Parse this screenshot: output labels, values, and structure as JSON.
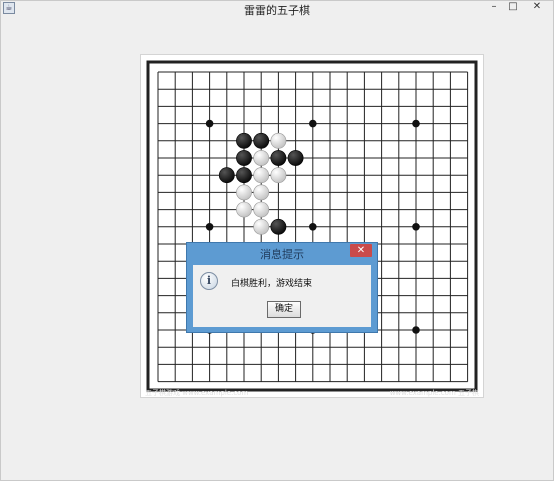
{
  "window": {
    "title": "雷雷的五子棋",
    "minimize_symbol": "–",
    "maximize_symbol": "□",
    "close_symbol": "✕",
    "icon": "java-cup-icon"
  },
  "board": {
    "size": 19,
    "line_color": "#222222",
    "star_points": [
      [
        3,
        3
      ],
      [
        9,
        3
      ],
      [
        15,
        3
      ],
      [
        3,
        9
      ],
      [
        9,
        9
      ],
      [
        15,
        9
      ],
      [
        3,
        15
      ],
      [
        9,
        15
      ],
      [
        15,
        15
      ]
    ],
    "stones": [
      {
        "col": 5,
        "row": 4,
        "color": "black"
      },
      {
        "col": 6,
        "row": 4,
        "color": "black"
      },
      {
        "col": 7,
        "row": 4,
        "color": "white"
      },
      {
        "col": 5,
        "row": 5,
        "color": "black"
      },
      {
        "col": 6,
        "row": 5,
        "color": "white"
      },
      {
        "col": 7,
        "row": 5,
        "color": "black"
      },
      {
        "col": 8,
        "row": 5,
        "color": "black"
      },
      {
        "col": 4,
        "row": 6,
        "color": "black"
      },
      {
        "col": 5,
        "row": 6,
        "color": "black"
      },
      {
        "col": 6,
        "row": 6,
        "color": "white"
      },
      {
        "col": 7,
        "row": 6,
        "color": "white"
      },
      {
        "col": 5,
        "row": 7,
        "color": "white"
      },
      {
        "col": 6,
        "row": 7,
        "color": "white"
      },
      {
        "col": 5,
        "row": 8,
        "color": "white"
      },
      {
        "col": 6,
        "row": 8,
        "color": "white"
      },
      {
        "col": 6,
        "row": 9,
        "color": "white"
      },
      {
        "col": 7,
        "row": 9,
        "color": "black"
      }
    ],
    "watermark_left": "五子棋游戏 www.example.com",
    "watermark_right": "www.example.com 五子棋"
  },
  "dialog": {
    "title": "消息提示",
    "close_symbol": "✕",
    "icon_glyph": "i",
    "message": "白棋胜利，游戏结束",
    "ok_label": "确定"
  }
}
